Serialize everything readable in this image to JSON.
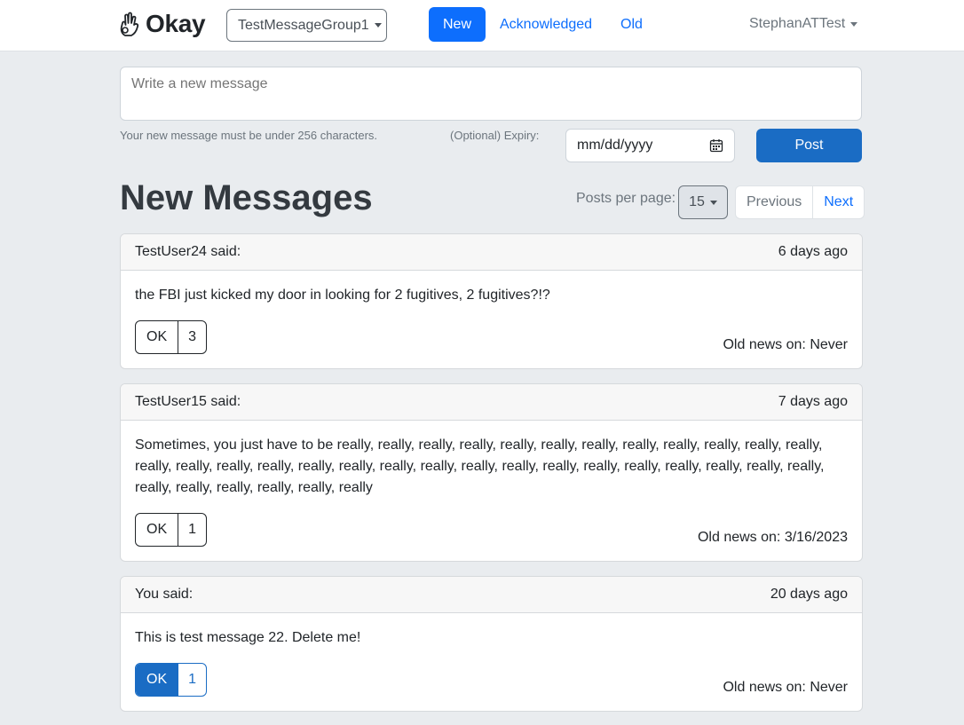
{
  "brand": {
    "name": "Okay",
    "icon": "ok-hand-icon"
  },
  "group_selector": {
    "value": "TestMessageGroup1"
  },
  "nav": {
    "tabs": [
      {
        "label": "New",
        "active": true
      },
      {
        "label": "Acknowledged",
        "active": false
      },
      {
        "label": "Old",
        "active": false
      }
    ]
  },
  "user": {
    "name": "StephanATTest"
  },
  "composer": {
    "placeholder": "Write a new message",
    "helper": "Your new message must be under 256 characters.",
    "expiry_label": "(Optional) Expiry:",
    "date_placeholder": "mm/dd/yyyy",
    "post_label": "Post"
  },
  "section": {
    "title": "New Messages",
    "posts_per_page_label": "Posts per page:",
    "posts_per_page": "15",
    "previous_label": "Previous",
    "next_label": "Next"
  },
  "messages": [
    {
      "author": "TestUser24 said:",
      "time": "6 days ago",
      "text": "the FBI just kicked my door in looking for 2 fugitives, 2 fugitives?!?",
      "ok_label": "OK",
      "ok_count": "3",
      "acknowledged": false,
      "old_news": "Old news on: Never"
    },
    {
      "author": "TestUser15 said:",
      "time": "7 days ago",
      "text": "Sometimes, you just have to be really, really, really, really, really, really, really, really, really, really, really, really, really, really, really, really, really, really, really, really, really, really, really, really, really, really, really, really, really, really, really, really, really, really, really",
      "ok_label": "OK",
      "ok_count": "1",
      "acknowledged": false,
      "old_news": "Old news on: 3/16/2023"
    },
    {
      "author": "You said:",
      "time": "20 days ago",
      "text": "This is test message 22. Delete me!",
      "ok_label": "OK",
      "ok_count": "1",
      "acknowledged": true,
      "old_news": "Old news on: Never"
    }
  ],
  "colors": {
    "primary": "#0d6efd",
    "post_button": "#1a6cc4",
    "background": "#e9ecef"
  }
}
